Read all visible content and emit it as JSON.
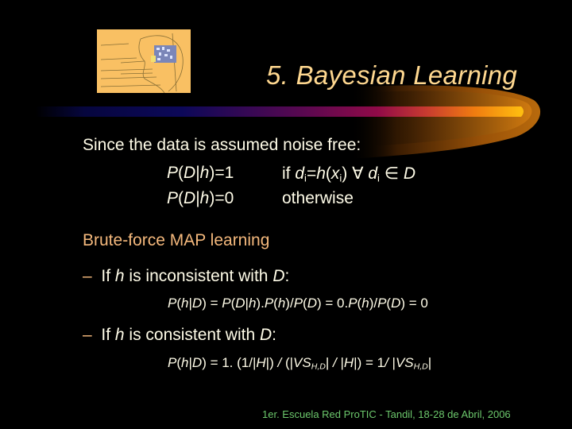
{
  "slide": {
    "title": "5. Bayesian Learning",
    "logo": "head-sketch-logo",
    "intro": "Since the data is assumed noise free:",
    "rules": [
      {
        "condition_lhs": "P(D|h)=1",
        "condition_rhs": "if di=h(xi) ∀ di ∈ D"
      },
      {
        "condition_lhs": "P(D|h)=0",
        "condition_rhs": "otherwise"
      }
    ],
    "section_heading": "Brute-force MAP learning",
    "bullets": [
      {
        "dash": "–",
        "label": "If h is inconsistent with D:",
        "equation": "P(h|D) = P(D|h).P(h)/P(D) = 0.P(h)/P(D) = 0"
      },
      {
        "dash": "–",
        "label": "If h is consistent with D:",
        "equation": "P(h|D) = 1. (1/|H|) / (|VSH,D| / |H|) = 1/ |VSH,D|"
      }
    ],
    "footer": "1er. Escuela Red ProTIC - Tandil, 18-28 de Abril, 2006"
  },
  "colors": {
    "background": "#000000",
    "title": "#FFD890",
    "body_text": "#FFFCE8",
    "heading_accent": "#F4B87C",
    "footer": "#6CC86C",
    "bar_start": "#0A0A5A",
    "bar_mid": "#8A0A4A",
    "bar_end": "#FFC010"
  }
}
